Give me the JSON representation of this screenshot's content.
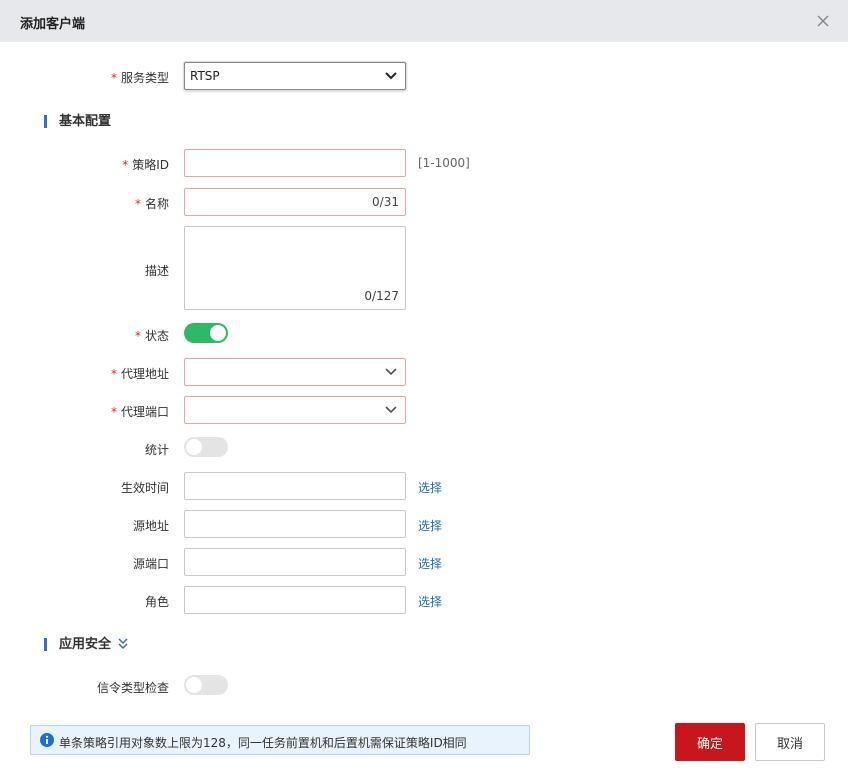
{
  "dialog": {
    "title": "添加客户端",
    "close_icon": "close-icon"
  },
  "service_type": {
    "label": "服务类型",
    "required": "*",
    "value": "RTSP"
  },
  "sections": {
    "basic": "基本配置",
    "app_security": "应用安全"
  },
  "fields": {
    "policy_id": {
      "label": "策略ID",
      "required": "*",
      "value": "",
      "hint": "[1-1000]"
    },
    "name": {
      "label": "名称",
      "required": "*",
      "value": "",
      "counter": "0/31"
    },
    "description": {
      "label": "描述",
      "value": "",
      "counter": "0/127"
    },
    "status": {
      "label": "状态",
      "required": "*",
      "on": true
    },
    "proxy_address": {
      "label": "代理地址",
      "required": "*",
      "value": ""
    },
    "proxy_port": {
      "label": "代理端口",
      "required": "*",
      "value": ""
    },
    "statistics": {
      "label": "统计",
      "on": false
    },
    "effective_time": {
      "label": "生效时间",
      "value": "",
      "link": "选择"
    },
    "source_address": {
      "label": "源地址",
      "value": "",
      "link": "选择"
    },
    "source_port": {
      "label": "源端口",
      "value": "",
      "link": "选择"
    },
    "role": {
      "label": "角色",
      "value": "",
      "link": "选择"
    },
    "signaling_check": {
      "label": "信令类型检查",
      "on": false
    }
  },
  "notice": {
    "text": "单条策略引用对象数上限为128，同一任务前置机和后置机需保证策略ID相同",
    "icon": "info-icon"
  },
  "buttons": {
    "ok": "确定",
    "cancel": "取消"
  },
  "colors": {
    "accent": "#c8161d",
    "toggle_on": "#2fb866",
    "link": "#1f6fb5",
    "required": "#d9262d",
    "section_bar": "#3d6cc4"
  }
}
